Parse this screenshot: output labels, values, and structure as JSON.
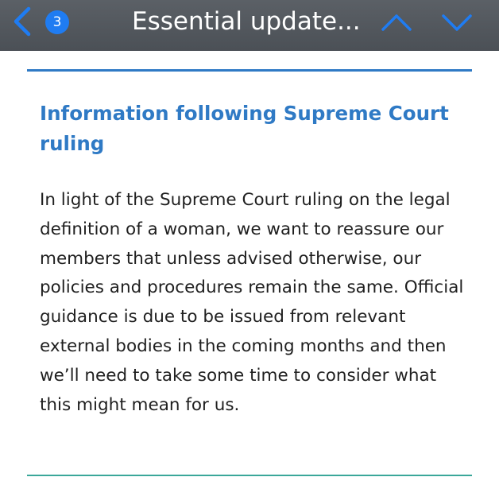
{
  "header": {
    "title": "Essential update...",
    "unread_count": "3",
    "icons": {
      "back": "chevron-left-icon",
      "previous": "chevron-up-icon",
      "next": "chevron-down-icon"
    },
    "accent_color": "#1f7cf2",
    "bar_color": "#53585e"
  },
  "article": {
    "heading": "Information following Supreme Court ruling",
    "body": "In light of the Supreme Court ruling on the legal definition of a woman, we want to reassure our members that unless advised otherwise, our policies and procedures remain the same. Official guidance is due to be issued from relevant external bodies in the coming months and then we’ll need to take some time to consider what this might mean for us.",
    "heading_color": "#2f7ac5",
    "top_rule_color": "#2f7ac5",
    "bottom_rule_color": "#3aa79a"
  }
}
